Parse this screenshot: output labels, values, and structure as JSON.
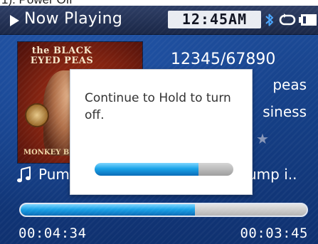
{
  "page_caption": "1). Power Off",
  "header": {
    "title": "Now Playing",
    "clock": "12:45AM",
    "icons": [
      "play-icon",
      "bluetooth-icon",
      "repeat-icon",
      "battery-icon"
    ]
  },
  "track": {
    "counter": "12345/67890",
    "artist": "peas",
    "album": "siness",
    "rating_symbol": "★",
    "title": "Pum",
    "title_tail": "ump i..",
    "progress_fraction": 0.61,
    "elapsed": "00:04:34",
    "remaining": "00:03:45"
  },
  "album_art": {
    "band_text": "the BLACK EYED PEAS",
    "subtitle": "MONKEY BUSINESS"
  },
  "dialog": {
    "message": "Continue to Hold to turn off.",
    "progress_fraction": 0.75
  },
  "colors": {
    "screen_blue": "#1a4690",
    "header_dark": "#22305a",
    "accent_progress": "#1aa3e8",
    "dialog_bg": "#ffffff"
  }
}
